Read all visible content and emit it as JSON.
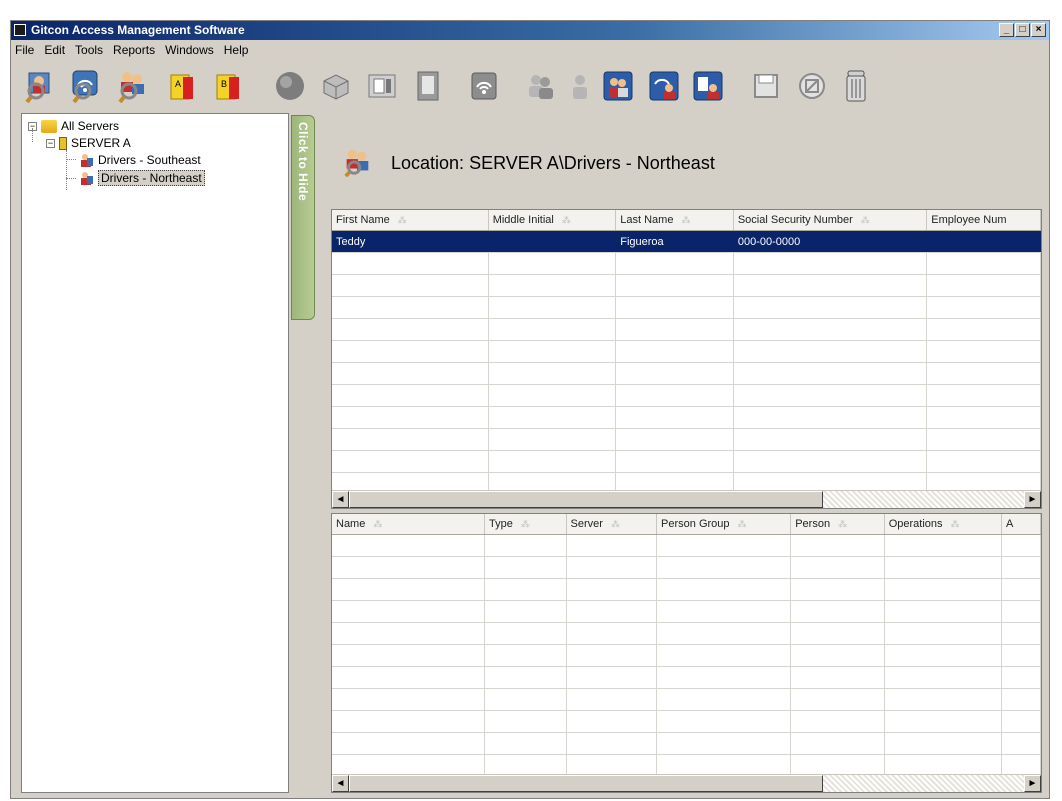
{
  "window": {
    "title": "Gitcon Access Management Software",
    "controls": [
      "_",
      "□",
      "×"
    ]
  },
  "menu": [
    "File",
    "Edit",
    "Tools",
    "Reports",
    "Windows",
    "Help"
  ],
  "toolbar": {
    "icons": [
      "person-search-icon",
      "wifi-person-search-icon",
      "group-search-icon",
      "yellow-report-icon",
      "yellow-red-report-icon",
      "globe-icon",
      "network-device-icon",
      "card-reader-icon",
      "panel-icon",
      "wireless-reader-icon",
      "group-icon",
      "person-icon",
      "person-group-blue-icon",
      "person-wifi-icon",
      "person-card-icon",
      "save-icon",
      "cancel-icon",
      "trash-icon"
    ]
  },
  "tree": {
    "root": "All Servers",
    "server": "SERVER A",
    "locations": [
      "Drivers - Southeast",
      "Drivers - Northeast"
    ],
    "selected_index": 1
  },
  "hide_tab": "Click to Hide",
  "location": {
    "label": "Location:",
    "path": "SERVER A\\Drivers - Northeast"
  },
  "persons_grid": {
    "columns": [
      "First Name",
      "Middle Initial",
      "Last Name",
      "Social Security Number",
      "Employee Num"
    ],
    "rows": [
      [
        "Teddy",
        "",
        "Figueroa",
        "000-00-0000",
        ""
      ]
    ],
    "selected_row": 0
  },
  "permissions_grid": {
    "columns": [
      "Name",
      "Type",
      "Server",
      "Person Group",
      "Person",
      "Operations",
      "A"
    ],
    "rows": []
  },
  "colors": {
    "title_bar": "#0a246a",
    "selection": "#0a246a",
    "hide_tab": "#9db57c",
    "window_bg": "#d4d0c8"
  }
}
